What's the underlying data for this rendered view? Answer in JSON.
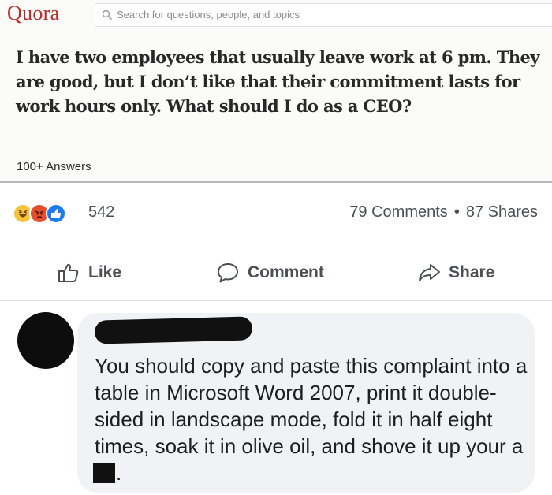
{
  "quora": {
    "logo": "Quora",
    "search_placeholder": "Search for questions, people, and topics",
    "question": "I have two employees that usually leave work at 6 pm. They are good, but I don’t like that their commitment lasts for work hours only. What should I do as a CEO?",
    "answers": "100+ Answers",
    "brand_color": "#b92b27"
  },
  "post": {
    "reaction_icons": [
      "haha-emoji-icon",
      "angry-emoji-icon",
      "like-thumb-icon"
    ],
    "reaction_count": "542",
    "comments": "79 Comments",
    "separator": "•",
    "shares": "87 Shares",
    "actions": {
      "like": "Like",
      "comment": "Comment",
      "share": "Share"
    }
  },
  "comment": {
    "text_before": "You should copy and paste this complaint into a table in Microsoft Word 2007, print it double-sided in landscape mode, fold it in half eight times, soak it in olive oil, and shove it up your a",
    "text_after": "."
  }
}
